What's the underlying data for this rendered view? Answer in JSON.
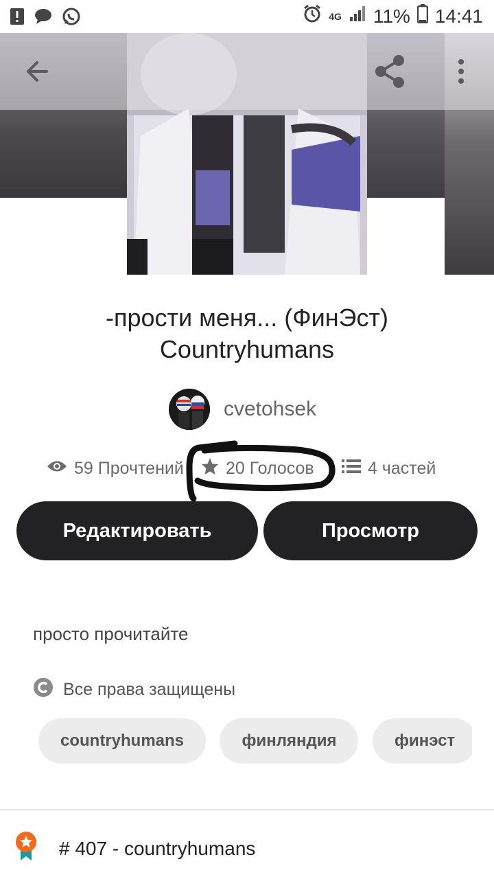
{
  "status_bar": {
    "network": "4G",
    "battery": "11%",
    "time": "14:41",
    "icons": [
      "alert-icon",
      "chat-icon",
      "whatsapp-icon",
      "alarm-icon",
      "signal-icon",
      "battery-icon"
    ]
  },
  "toolbar": {
    "icons": [
      "back-arrow-icon",
      "share-icon",
      "more-vert-icon"
    ]
  },
  "story": {
    "title_line1": "-прости меня... (ФинЭст)",
    "title_line2": "Countryhumans",
    "author": "cvetohsek",
    "reads": "59 Прочтений",
    "votes": "20 Голосов",
    "parts": "4 частей",
    "description": "просто прочитайте",
    "rights": "Все права защищены"
  },
  "actions": {
    "edit_label": "Редактировать",
    "view_label": "Просмотр"
  },
  "tags": [
    "countryhumans",
    "финляндия",
    "финэст"
  ],
  "ranking": {
    "label": "# 407 - countryhumans",
    "badge_color": "#f26a1b"
  },
  "colors": {
    "button_bg": "#222123",
    "tag_bg": "#ececec",
    "annotation": "#111111"
  }
}
